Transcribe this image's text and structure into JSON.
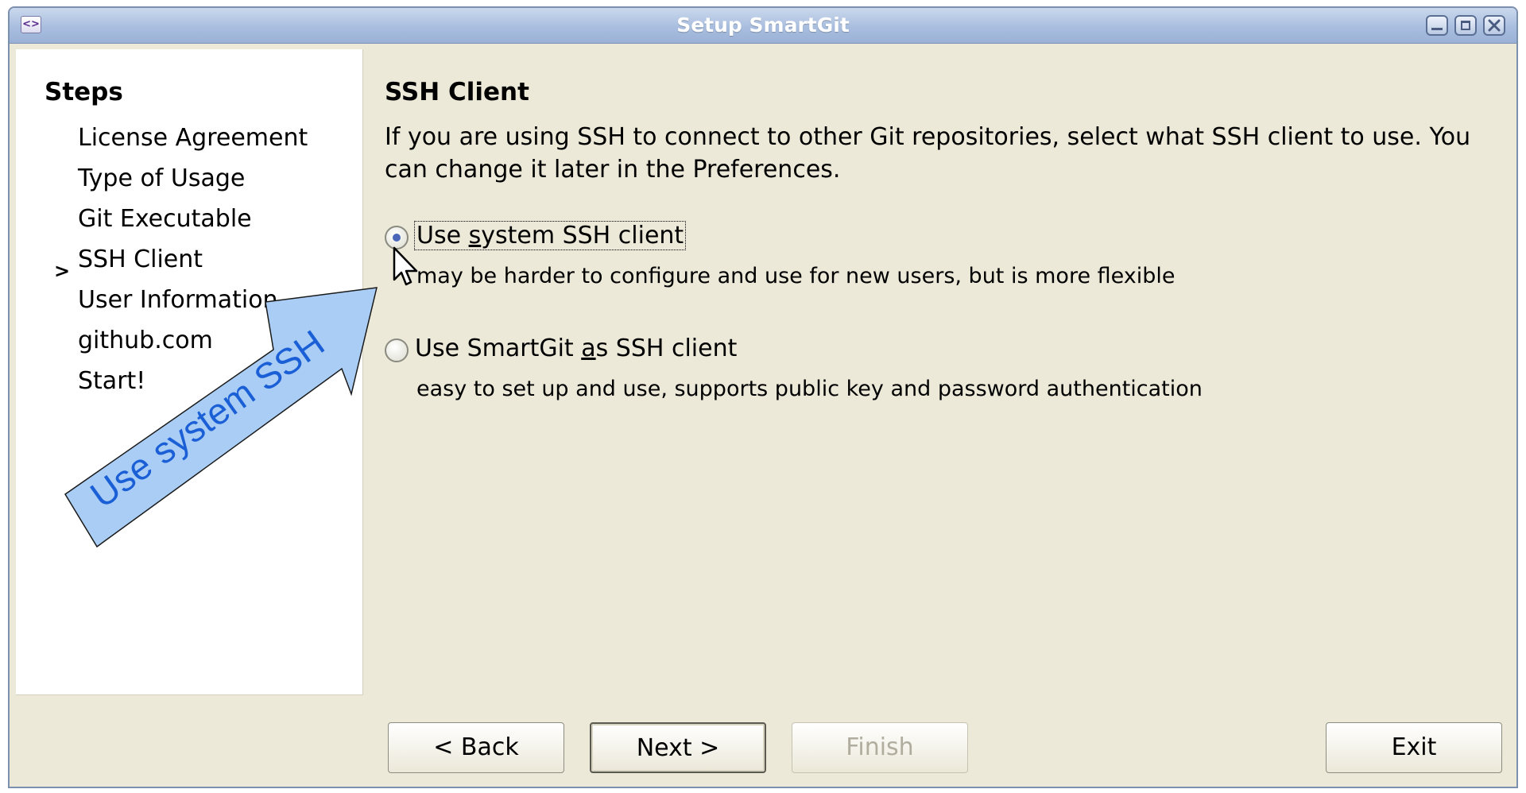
{
  "window": {
    "title": "Setup SmartGit",
    "app_icon": "<>"
  },
  "steps": {
    "title": "Steps",
    "current_marker": ">",
    "items": [
      {
        "label": "License Agreement",
        "current": false
      },
      {
        "label": "Type of Usage",
        "current": false
      },
      {
        "label": "Git Executable",
        "current": false
      },
      {
        "label": "SSH Client",
        "current": true
      },
      {
        "label": "User Information",
        "current": false
      },
      {
        "label": "github.com",
        "current": false
      },
      {
        "label": "Start!",
        "current": false
      }
    ]
  },
  "content": {
    "title": "SSH Client",
    "description": "If you are using SSH to connect to other Git repositories, select what SSH client to use. You can change it later in the Preferences.",
    "options": [
      {
        "label_pre": "Use ",
        "label_mnemonic": "s",
        "label_post": "ystem SSH client",
        "hint": "may be harder to configure and use for new users, but is more flexible",
        "selected": true
      },
      {
        "label_pre": "Use SmartGit ",
        "label_mnemonic": "a",
        "label_post": "s SSH client",
        "hint": "easy to set up and use, supports public key and password authentication",
        "selected": false
      }
    ]
  },
  "buttons": {
    "back": "< Back",
    "next": "Next >",
    "finish": "Finish",
    "exit": "Exit"
  },
  "annotation": {
    "text": "Use system SSH",
    "color": "#a9cdf5"
  }
}
